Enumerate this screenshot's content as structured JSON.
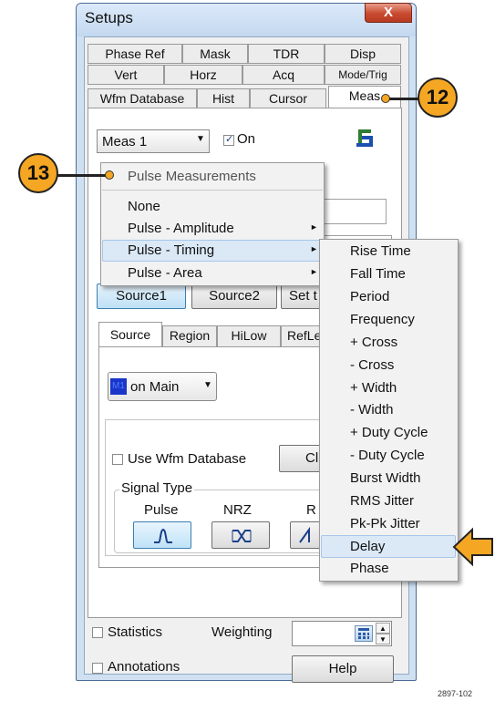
{
  "dialog": {
    "title": "Setups",
    "close_label": "X"
  },
  "tabs": {
    "row1": [
      "Phase Ref",
      "Mask",
      "TDR",
      "Disp"
    ],
    "row2": [
      "Vert",
      "Horz",
      "Acq",
      "Mode/Trig"
    ],
    "row3": [
      "Wfm Database",
      "Hist",
      "Cursor",
      "Meas"
    ],
    "selected": "Meas"
  },
  "meas": {
    "select_value": "Meas 1",
    "on_label": "On",
    "on_checked": true
  },
  "context_menu": {
    "header": "Pulse Measurements",
    "items": [
      "None",
      "Pulse - Amplitude",
      "Pulse - Timing",
      "Pulse - Area"
    ],
    "highlighted": "Pulse - Timing"
  },
  "submenu": {
    "items": [
      "Rise Time",
      "Fall Time",
      "Period",
      "Frequency",
      "+ Cross",
      "- Cross",
      "+ Width",
      "- Width",
      "+ Duty Cycle",
      "- Duty Cycle",
      "Burst Width",
      "RMS Jitter",
      "Pk-Pk Jitter",
      "Delay",
      "Phase"
    ],
    "highlighted": "Delay"
  },
  "source_buttons": [
    "Source1",
    "Source2",
    "Set t"
  ],
  "inner_tabs": [
    "Source",
    "Region",
    "HiLow",
    "RefLe"
  ],
  "source_select": {
    "badge": "M1",
    "value": "on Main"
  },
  "use_wfm_database": "Use Wfm Database",
  "cl_button": "Cl",
  "signal_type": {
    "label": "Signal Type",
    "options": [
      "Pulse",
      "NRZ",
      "RZ"
    ],
    "rz_partial": "R"
  },
  "footer": {
    "statistics": "Statistics",
    "weighting": "Weighting",
    "annotations": "Annotations",
    "help": "Help"
  },
  "callouts": {
    "c12": "12",
    "c13": "13"
  },
  "figure_id": "2897-102",
  "colors": {
    "callout": "#f5a623",
    "highlight": "#dbe8f6",
    "frame": "#cfe0f1",
    "badge": "#1a36c8",
    "accent_button": "#cde6f7"
  }
}
